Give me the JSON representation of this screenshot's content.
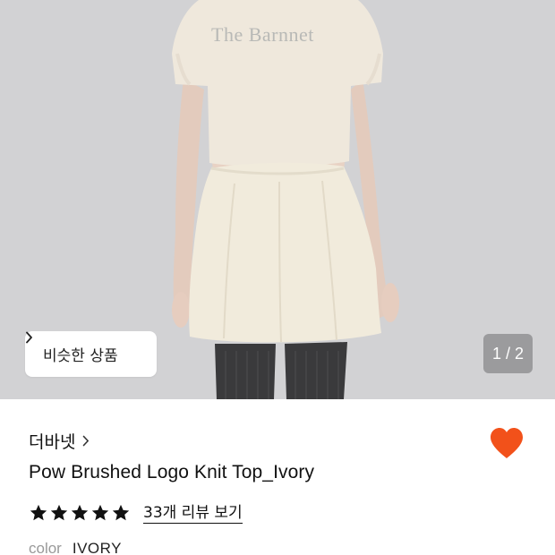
{
  "hero": {
    "shirt_logo_text": "The Barnnet",
    "similar_products_label": "비슷한 상품",
    "page_counter": "1 / 2"
  },
  "product": {
    "brand": "더바넷",
    "name": "Pow Brushed Logo Knit Top_Ivory",
    "rating": 5,
    "review_link": "33개 리뷰 보기",
    "color_label": "color",
    "color_value": "IVORY",
    "liked": true
  },
  "colors": {
    "heart": "#f2511a",
    "star": "#111111",
    "background": "#ffffff"
  }
}
